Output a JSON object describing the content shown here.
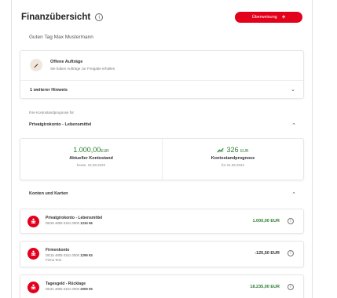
{
  "header": {
    "title": "Finanzübersicht",
    "info_glyph": "i",
    "transfer_label": "Überweisung",
    "transfer_plus": "+"
  },
  "greeting": "Guten Tag Max Mustermann",
  "orders": {
    "icon": "pen-icon",
    "title": "Offene Aufträge",
    "subtitle": "Sie haben Aufträge zur Freigabe erhalten",
    "hint_label": "1 weiterer Hinweis",
    "chevron": "⌄"
  },
  "forecast": {
    "caption": "Ihre Kontostandprognose für",
    "account_title": "Privatgirokonto - Lebensmittel",
    "chevron": "⌃",
    "current": {
      "amount": "1.000,00",
      "unit": "EUR",
      "label": "Aktueller Kontostand",
      "date": "heute, 15.08.2022"
    },
    "forecast_value": {
      "amount": "326",
      "unit": "EUR",
      "label": "Kontostandprognose",
      "date": "für 31.08.2022"
    }
  },
  "accounts_section": {
    "title": "Konten und Karten",
    "chevron": "⌃"
  },
  "accounts": [
    {
      "name": "Privatgirokonto - Lebensmittel",
      "iban_prefix": "DE28 4805 0161 0000",
      "iban_suffix": "1234 56",
      "extra": "",
      "amount": "1.000,00 EUR",
      "info": "i"
    },
    {
      "name": "Firmenkonto",
      "iban_prefix": "DE15 4805 0161 0000",
      "iban_suffix": "1299 93",
      "extra": "Firma Test",
      "amount": "-125,50 EUR",
      "info": "i"
    },
    {
      "name": "Tagesgeld - Rücklage",
      "iban_prefix": "DE31 4805 0161 0000",
      "iban_suffix": "2009 05",
      "extra": "",
      "amount": "18.235,00 EUR",
      "info": "i"
    }
  ],
  "colors": {
    "brand": "#e3001b",
    "positive": "#2e7d32"
  }
}
